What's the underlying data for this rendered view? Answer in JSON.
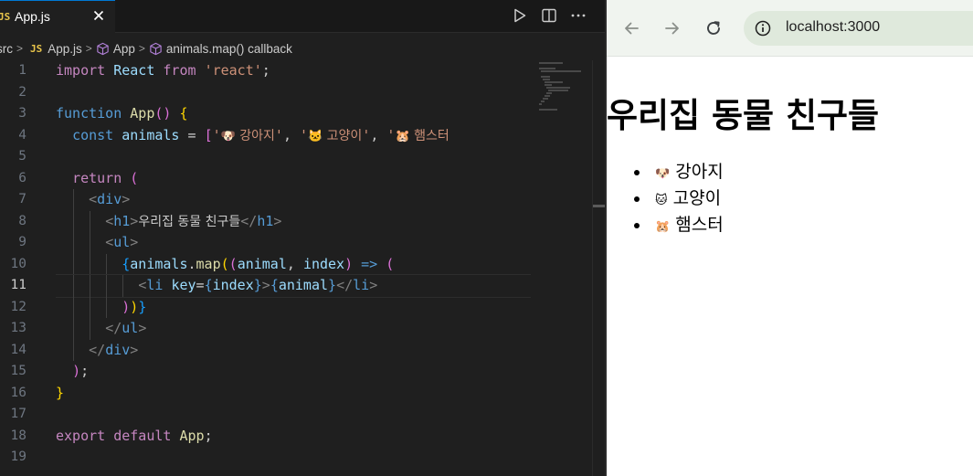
{
  "editor": {
    "tab": {
      "lang_badge": "JS",
      "label": "App.js"
    },
    "breadcrumb": {
      "items": [
        {
          "label": "src"
        },
        {
          "label": "App.js",
          "badge": "JS"
        },
        {
          "label": "App",
          "icon": "cube-icon"
        },
        {
          "label": "animals.map() callback",
          "icon": "cube-icon"
        }
      ]
    },
    "line_numbers": [
      "1",
      "2",
      "3",
      "4",
      "5",
      "6",
      "7",
      "8",
      "9",
      "10",
      "11",
      "12",
      "13",
      "14",
      "15",
      "16",
      "17",
      "18",
      "19"
    ],
    "active_line": 11,
    "code": {
      "l1": {
        "kw": "import",
        "id": "React",
        "from": "from",
        "str": "'react'",
        "end": ";"
      },
      "l3": {
        "kw": "function",
        "name": "App",
        "parens": "()",
        "brace": "{"
      },
      "l4": {
        "kw": "const",
        "var": "animals",
        "eq": "=",
        "open": "[",
        "s1q": "'",
        "s1e": "🐶",
        "s1t": " 강아지",
        "s1c": "'",
        "comma1": ", ",
        "s2q": "'",
        "s2e": "🐱",
        "s2t": " 고양이",
        "s2c": "'",
        "comma2": ", ",
        "s3q": "'",
        "s3e": "🐹",
        "s3t": " 햄스터"
      },
      "l6": {
        "kw": "return",
        "paren": "("
      },
      "l7": {
        "lt": "<",
        "tag": "div",
        "gt": ">"
      },
      "l8": {
        "lt": "<",
        "tag": "h1",
        "gt": ">",
        "text": "우리집 동물 친구들",
        "lt2": "</",
        "tag2": "h1",
        "gt2": ">"
      },
      "l9": {
        "lt": "<",
        "tag": "ul",
        "gt": ">"
      },
      "l10": {
        "brace": "{",
        "obj": "animals",
        "dot": ".",
        "method": "map",
        "p1": "(",
        "p2": "(",
        "arg1": "animal",
        "comma": ", ",
        "arg2": "index",
        "p3": ")",
        "arrow": " => ",
        "p4": "("
      },
      "l11": {
        "lt": "<",
        "tag": "li",
        "attr": "key",
        "eq": "=",
        "b1": "{",
        "val": "index",
        "b2": "}",
        "gt": ">",
        "b3": "{",
        "child": "animal",
        "b4": "}",
        "lt2": "</",
        "tag2": "li",
        "gt2": ">"
      },
      "l12": {
        "p1": ")",
        "p2": ")",
        "brace": "}"
      },
      "l13": {
        "lt": "</",
        "tag": "ul",
        "gt": ">"
      },
      "l14": {
        "lt": "</",
        "tag": "div",
        "gt": ">"
      },
      "l15": {
        "paren": ")",
        "semi": ";"
      },
      "l16": {
        "brace": "}"
      },
      "l18": {
        "kw1": "export",
        "kw2": "default",
        "name": "App",
        "semi": ";"
      }
    }
  },
  "browser": {
    "url": "localhost:3000",
    "heading": "우리집 동물 친구들",
    "list": [
      {
        "emoji": "🐶",
        "name": "강아지"
      },
      {
        "emoji": "🐱",
        "name": "고양이"
      },
      {
        "emoji": "🐹",
        "name": "햄스터"
      }
    ]
  },
  "colors": {
    "keyword": "#c586c0",
    "storage": "#569cd6",
    "function": "#dcdcaa",
    "variable": "#9cdcfe",
    "string": "#ce9178",
    "bracket_gold": "#ffd700",
    "bracket_pink": "#da70d6",
    "bracket_blue": "#179fff",
    "tab_accent": "#0078d4",
    "browser_toolbar": "#f0f4ef"
  }
}
